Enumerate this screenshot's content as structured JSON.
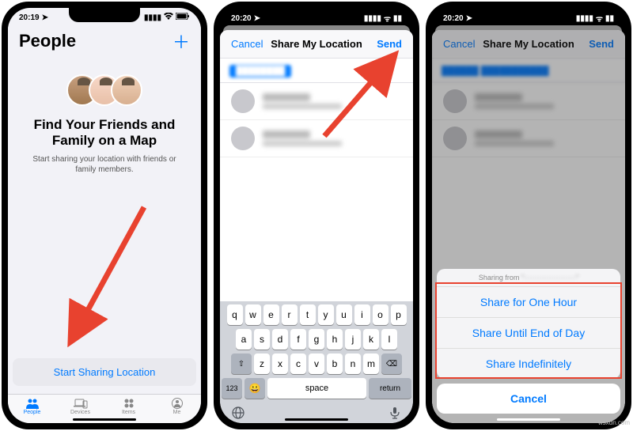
{
  "watermark": "wsxdn.com",
  "screen1": {
    "status": {
      "time": "20:19",
      "location_icon": "▸"
    },
    "header": {
      "title": "People",
      "add": "＋"
    },
    "headline": "Find Your Friends and Family on a Map",
    "subtext": "Start sharing your location with friends or family members.",
    "start_button": "Start Sharing Location",
    "tabs": [
      {
        "label": "People",
        "active": true
      },
      {
        "label": "Devices",
        "active": false
      },
      {
        "label": "Items",
        "active": false
      },
      {
        "label": "Me",
        "active": false
      }
    ]
  },
  "screen2": {
    "status": {
      "time": "20:20"
    },
    "modal": {
      "cancel": "Cancel",
      "title": "Share My Location",
      "send": "Send"
    },
    "keyboard": {
      "row1": [
        "q",
        "w",
        "e",
        "r",
        "t",
        "y",
        "u",
        "i",
        "o",
        "p"
      ],
      "row2": [
        "a",
        "s",
        "d",
        "f",
        "g",
        "h",
        "j",
        "k",
        "l"
      ],
      "row3": [
        "z",
        "x",
        "c",
        "v",
        "b",
        "n",
        "m"
      ],
      "shift": "⇧",
      "delete": "⌫",
      "numbers": "123",
      "space": "space",
      "return": "return"
    }
  },
  "screen3": {
    "status": {
      "time": "20:20"
    },
    "modal": {
      "cancel": "Cancel",
      "title": "Share My Location",
      "send": "Send"
    },
    "sheet": {
      "label_prefix": "Sharing from",
      "label_value": "\"······················\"",
      "options": [
        "Share for One Hour",
        "Share Until End of Day",
        "Share Indefinitely"
      ],
      "cancel": "Cancel"
    }
  }
}
